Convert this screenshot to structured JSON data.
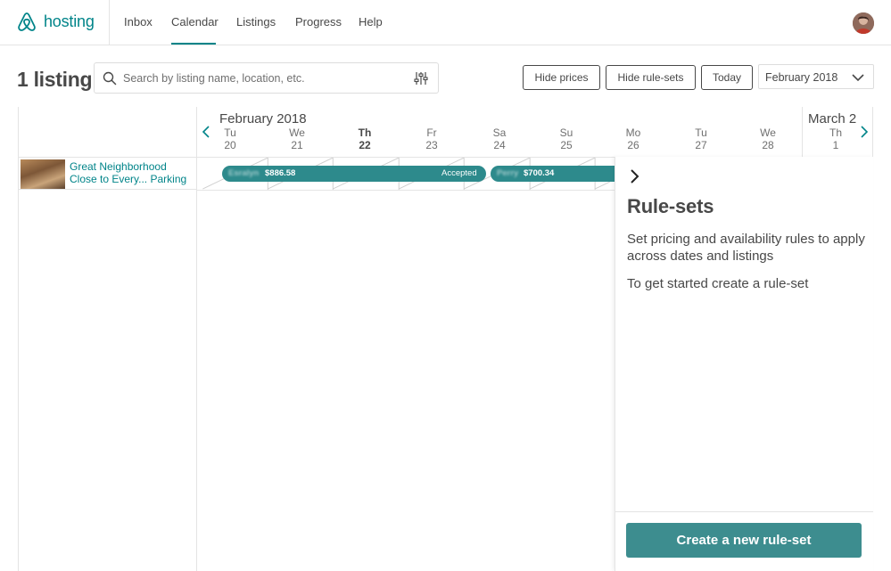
{
  "nav": {
    "brand": "hosting",
    "items": [
      {
        "label": "Inbox"
      },
      {
        "label": "Calendar"
      },
      {
        "label": "Listings"
      },
      {
        "label": "Progress"
      },
      {
        "label": "Help"
      }
    ],
    "active": "Calendar"
  },
  "toolbar": {
    "listing_count": "1 listing",
    "search_placeholder": "Search by listing name, location, etc.",
    "hide_prices": "Hide prices",
    "hide_rule_sets": "Hide rule-sets",
    "today": "Today",
    "month_selected": "February 2018"
  },
  "calendar": {
    "month_current": "February 2018",
    "month_next": "March 2",
    "days": [
      {
        "dow": "Tu",
        "date": "20"
      },
      {
        "dow": "We",
        "date": "21"
      },
      {
        "dow": "Th",
        "date": "22",
        "today": true
      },
      {
        "dow": "Fr",
        "date": "23"
      },
      {
        "dow": "Sa",
        "date": "24"
      },
      {
        "dow": "Su",
        "date": "25"
      },
      {
        "dow": "Mo",
        "date": "26"
      },
      {
        "dow": "Tu",
        "date": "27"
      },
      {
        "dow": "We",
        "date": "28"
      },
      {
        "dow": "Th",
        "date": "1"
      }
    ]
  },
  "listing": {
    "name": "Great Neighborhood Close to Every... Parking"
  },
  "reservations": [
    {
      "guest": "Esralyn",
      "price": "$886.58",
      "status": "Accepted"
    },
    {
      "guest": "Perry",
      "price": "$700.34",
      "status": ""
    }
  ],
  "rule_sets_panel": {
    "title": "Rule-sets",
    "description": "Set pricing and availability rules to apply across dates and listings",
    "hint": "To get started create a rule-set",
    "create_button": "Create a new rule-set"
  },
  "colors": {
    "accent": "#008489",
    "reservation": "#2d8a8c",
    "button": "#3d8d8f"
  }
}
